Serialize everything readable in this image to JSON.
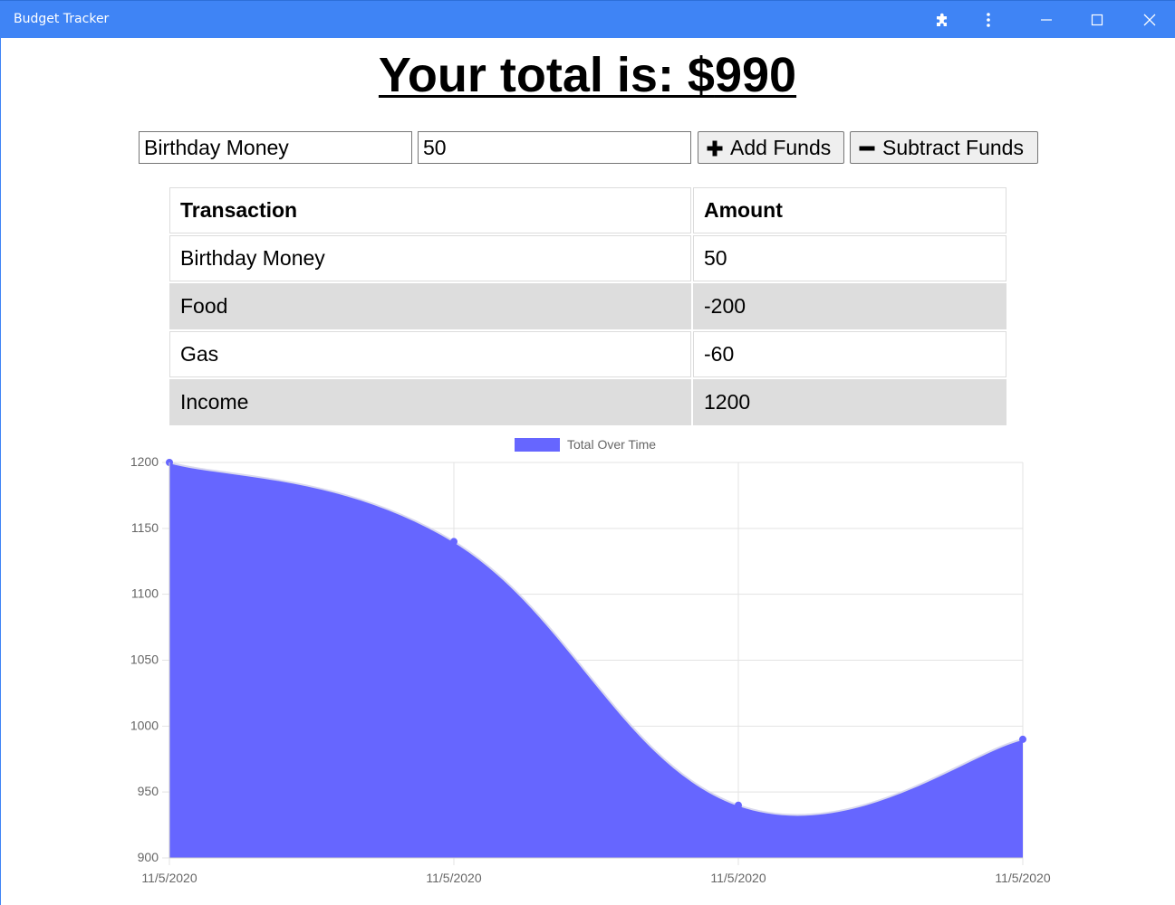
{
  "window": {
    "title": "Budget Tracker"
  },
  "icons": {
    "extensions": "puzzle-icon",
    "more": "kebab-menu-icon",
    "minimize": "minimize-icon",
    "maximize": "maximize-icon",
    "close": "close-icon",
    "add": "plus-icon",
    "subtract": "minus-icon"
  },
  "header": {
    "total_label": "Your total is: $",
    "total_value": "990"
  },
  "form": {
    "name_value": "Birthday Money",
    "amount_value": "50",
    "add_label": "Add Funds",
    "subtract_label": "Subtract Funds"
  },
  "table": {
    "headers": [
      "Transaction",
      "Amount"
    ],
    "rows": [
      {
        "name": "Birthday Money",
        "amount": "50"
      },
      {
        "name": "Food",
        "amount": "-200"
      },
      {
        "name": "Gas",
        "amount": "-60"
      },
      {
        "name": "Income",
        "amount": "1200"
      }
    ]
  },
  "colors": {
    "titlebar": "#3f84f5",
    "series_fill": "#6666ff",
    "row_shade": "#dddddd"
  },
  "chart_data": {
    "type": "area",
    "title": "",
    "xlabel": "",
    "ylabel": "",
    "categories": [
      "11/5/2020",
      "11/5/2020",
      "11/5/2020",
      "11/5/2020"
    ],
    "series": [
      {
        "name": "Total Over Time",
        "values": [
          1200,
          1140,
          940,
          990
        ]
      }
    ],
    "ylim": [
      900,
      1200
    ],
    "yticks": [
      900,
      950,
      1000,
      1050,
      1100,
      1150,
      1200
    ],
    "legend": "top",
    "grid": true
  }
}
